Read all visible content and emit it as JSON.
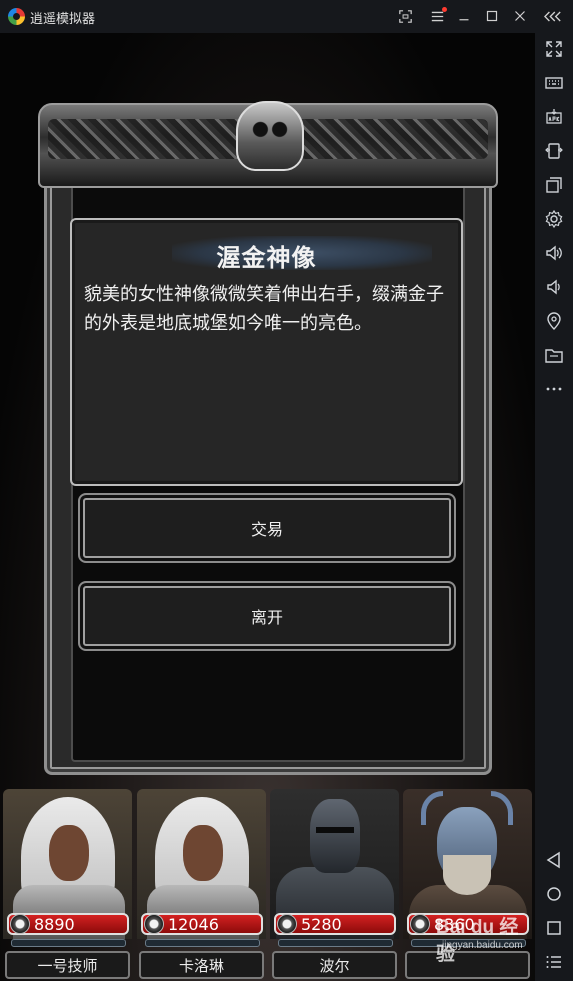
{
  "window": {
    "title": "逍遥模拟器"
  },
  "titlebar": {
    "buttons": [
      {
        "icon": "screen-capture-icon"
      },
      {
        "icon": "menu-icon",
        "has_notification": true
      },
      {
        "icon": "minimize-icon"
      },
      {
        "icon": "maximize-icon"
      },
      {
        "icon": "close-icon"
      },
      {
        "icon": "collapse-sidebar-icon"
      }
    ]
  },
  "sidebar": {
    "items": [
      {
        "icon": "fullscreen-icon"
      },
      {
        "icon": "keyboard-icon"
      },
      {
        "icon": "apk-install-icon"
      },
      {
        "icon": "shake-icon"
      },
      {
        "icon": "multi-window-icon"
      },
      {
        "icon": "settings-icon"
      },
      {
        "icon": "volume-up-icon"
      },
      {
        "icon": "volume-down-icon"
      },
      {
        "icon": "location-icon"
      },
      {
        "icon": "folder-icon"
      },
      {
        "icon": "more-icon"
      },
      {
        "icon": "back-icon"
      },
      {
        "icon": "home-icon"
      },
      {
        "icon": "recent-apps-icon"
      },
      {
        "icon": "nav-menu-icon"
      }
    ]
  },
  "dialog": {
    "title": "渥金神像",
    "text": "貌美的女性神像微微笑着伸出右手，缀满金子的外表是地底城堡如今唯一的亮色。",
    "options": [
      {
        "label": "交易"
      },
      {
        "label": "离开"
      }
    ]
  },
  "party": [
    {
      "name": "一号技师",
      "hp": "8890",
      "portrait": "cleric"
    },
    {
      "name": "卡洛琳",
      "hp": "12046",
      "portrait": "cleric"
    },
    {
      "name": "波尔",
      "hp": "5280",
      "portrait": "knight"
    },
    {
      "name": "",
      "hp": "8360",
      "portrait": "beast"
    }
  ],
  "watermark": {
    "text": "Bai du 经验",
    "sub": "jingyan.baidu.com"
  },
  "colors": {
    "hp_bar": "#c41616",
    "chrome": "#16181c"
  }
}
